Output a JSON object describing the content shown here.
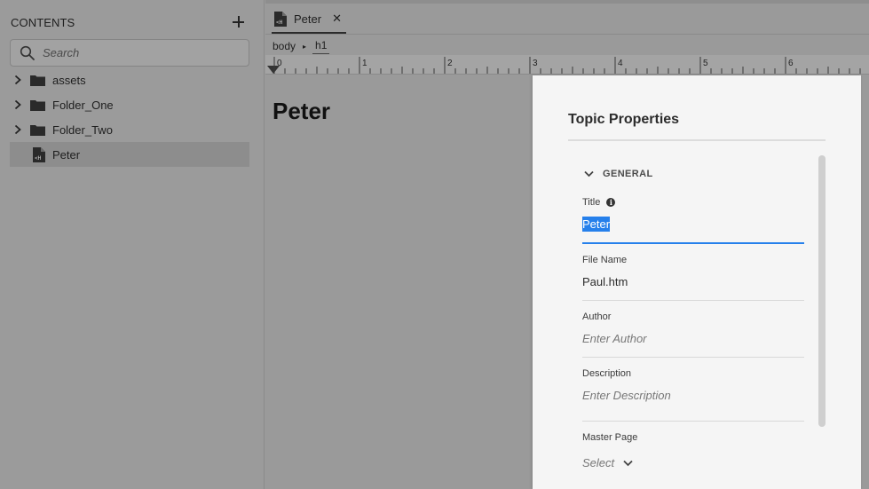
{
  "sidebar": {
    "title": "CONTENTS",
    "search_placeholder": "Search",
    "items": [
      {
        "label": "assets",
        "type": "folder"
      },
      {
        "label": "Folder_One",
        "type": "folder"
      },
      {
        "label": "Folder_Two",
        "type": "folder"
      },
      {
        "label": "Peter",
        "type": "file",
        "selected": true
      }
    ]
  },
  "editor": {
    "tab_label": "Peter",
    "tab_close": "✕",
    "breadcrumb": [
      "body",
      "h1"
    ],
    "breadcrumb_sep": "▸",
    "ruler_numbers": [
      "0",
      "1",
      "2",
      "3",
      "4",
      "5",
      "6"
    ],
    "heading": "Peter"
  },
  "panel": {
    "title": "Topic Properties",
    "section": "GENERAL",
    "title_label": "Title",
    "title_value": "Peter",
    "filename_label": "File Name",
    "filename_value": "Paul.htm",
    "author_label": "Author",
    "author_placeholder": "Enter Author",
    "description_label": "Description",
    "description_placeholder": "Enter Description",
    "masterpage_label": "Master Page",
    "masterpage_value": "Select"
  },
  "colors": {
    "accent": "#2680eb",
    "overlay_background": "#9a9a9a",
    "panel_background": "#f5f5f5"
  }
}
